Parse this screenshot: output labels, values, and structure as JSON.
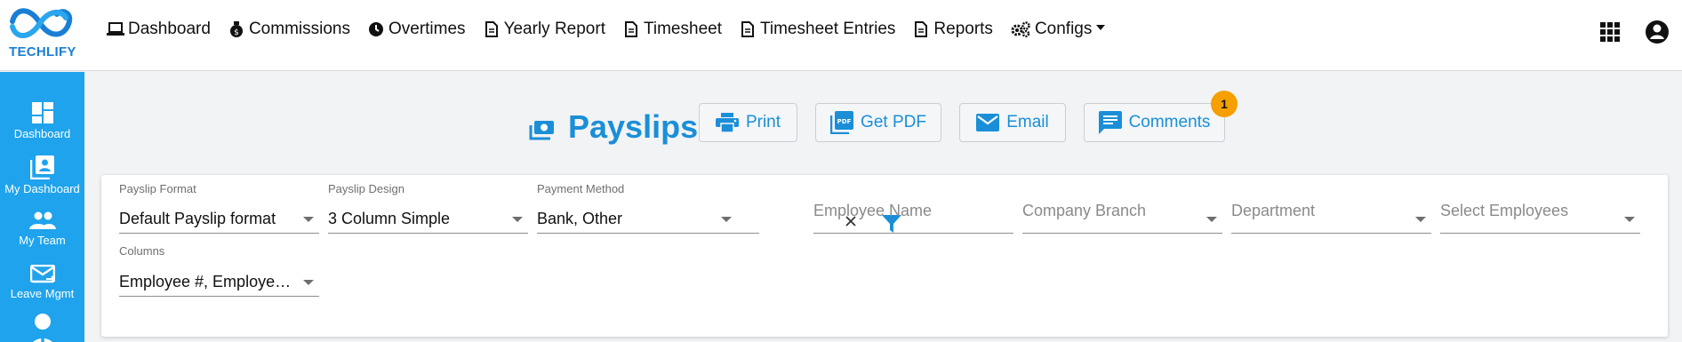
{
  "brand": {
    "logo_text": "TECHLIFY"
  },
  "nav": {
    "items": [
      {
        "label": "Dashboard",
        "icon": "laptop-icon"
      },
      {
        "label": "Commissions",
        "icon": "money-bag-icon"
      },
      {
        "label": "Overtimes",
        "icon": "clock-icon"
      },
      {
        "label": "Yearly Report",
        "icon": "file-icon"
      },
      {
        "label": "Timesheet",
        "icon": "file-icon"
      },
      {
        "label": "Timesheet Entries",
        "icon": "file-icon"
      },
      {
        "label": "Reports",
        "icon": "file-icon"
      },
      {
        "label": "Configs",
        "icon": "gears-icon"
      }
    ]
  },
  "sidebar": {
    "items": [
      {
        "label": "Dashboard",
        "icon": "dashboard-icon"
      },
      {
        "label": "My Dashboard",
        "icon": "portrait-icon"
      },
      {
        "label": "My Team",
        "icon": "group-icon"
      },
      {
        "label": "Leave Mgmt",
        "icon": "mail-icon"
      },
      {
        "label": "",
        "icon": "person-icon"
      }
    ]
  },
  "page": {
    "title": "Payslips",
    "actions": {
      "print": "Print",
      "pdf": "Get PDF",
      "email": "Email",
      "comments": "Comments",
      "comments_badge": "1"
    }
  },
  "filters": {
    "payslip_format": {
      "label": "Payslip Format",
      "value": "Default Payslip format"
    },
    "payslip_design": {
      "label": "Payslip Design",
      "value": "3 Column Simple"
    },
    "payment_method": {
      "label": "Payment Method",
      "value": "Bank, Other"
    },
    "employee_name": {
      "placeholder": "Employee Name"
    },
    "company_branch": {
      "placeholder": "Company Branch"
    },
    "department": {
      "placeholder": "Department"
    },
    "select_employees": {
      "placeholder": "Select Employees"
    },
    "columns": {
      "label": "Columns",
      "value": "Employee #, Employee, Designation, Department"
    }
  },
  "colors": {
    "accent": "#1a8fd8",
    "sidebar": "#1fa3ec",
    "badge": "#f59f00"
  }
}
